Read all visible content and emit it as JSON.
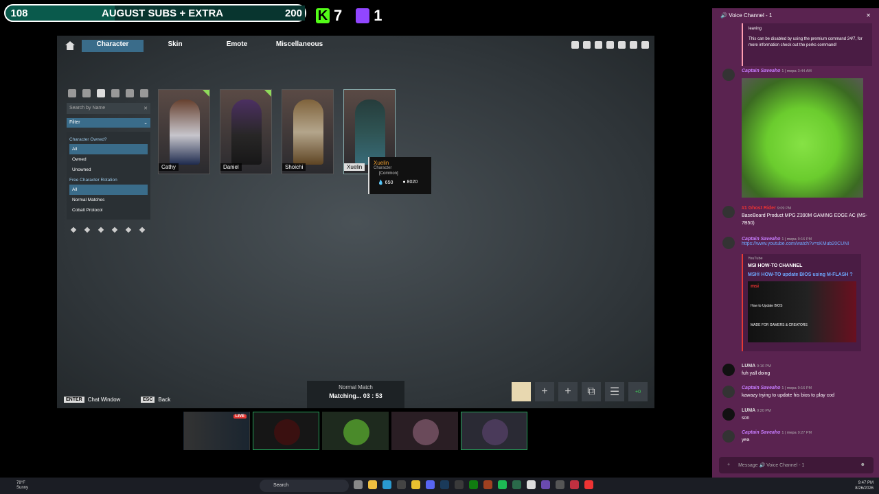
{
  "stream": {
    "sub_current": "108",
    "sub_label": "AUGUST SUBS + EXTRA",
    "sub_goal": "200",
    "sub_progress_pct": 54,
    "kick_count": "7",
    "twitch_count": "1"
  },
  "game": {
    "tabs": [
      "Character",
      "Skin",
      "Emote",
      "Miscellaneous"
    ],
    "search_placeholder": "Search by Name",
    "filter_label": "Filter",
    "owned_header": "Character Owned?",
    "owned_options": [
      "All",
      "Owned",
      "Unowned"
    ],
    "rotation_header": "Free Character Rotation",
    "rotation_options": [
      "All",
      "Normal Matches",
      "Cobalt Protocol"
    ],
    "characters": [
      "Cathy",
      "Daniel",
      "Shoichi",
      "Xuelin"
    ],
    "tooltip": {
      "name": "Xuelin",
      "type": "Character",
      "rarity": "[Common]",
      "cost1": "650",
      "cost2": "8020"
    },
    "hint_enter_key": "ENTER",
    "hint_enter_label": "Chat Window",
    "hint_esc_key": "ESC",
    "hint_esc_label": "Back",
    "match_mode": "Normal Match",
    "match_status": "Matching... 03 : 53",
    "friend_count": "+0"
  },
  "cams": {
    "live_badge": "LIVE"
  },
  "discord": {
    "channel": "Voice Channel - 1",
    "bot_text_1": "leaving",
    "bot_text_2": "This can be disabled by using the premium command 24/7, for more information check out the perks command!",
    "m1_user": "Captain Saveaho",
    "m1_badge": "1 | mepa",
    "m1_time": "3:44 AM",
    "m2_user": "#1 Ghost Rider",
    "m2_time": "9:09 PM",
    "m2_text": "BaseBoard Product   MPG Z390M GAMING EDGE AC (MS-7B50)",
    "m3_user": "Captain Saveaho",
    "m3_badge": "1 | mepa",
    "m3_time": "9:16 PM",
    "m3_link": "https://www.youtube.com/watch?v=sKMub20CUNI",
    "embed_source": "YouTube",
    "embed_channel": "MSI HOW-TO CHANNEL",
    "embed_title": "MSI® HOW-TO update BIOS using M-FLASH ?",
    "embed_thumb_text": "How to Update BIOS",
    "embed_thumb_sub": "MADE FOR GAMERS & CREATORS",
    "m4_user": "LUMA",
    "m4_time": "9:16 PM",
    "m4_text": "fuh yall doing",
    "m5_user": "Captain Saveaho",
    "m5_badge": "1 | mepa",
    "m5_time": "9:16 PM",
    "m5_text": "kawazy trying to update his bios to play cod",
    "m6_user": "LUMA",
    "m6_time": "9:20 PM",
    "m6_text": "son",
    "m7_user": "Captain Saveaho",
    "m7_badge": "1 | mepa",
    "m7_time": "9:27 PM",
    "m7_text": "yea",
    "composer_placeholder": "Message 🔊 Voice Channel - 1"
  },
  "taskbar": {
    "temp": "78°F",
    "weather": "Sunny",
    "search": "Search",
    "time": "9:47 PM",
    "date": "8/26/2026"
  }
}
